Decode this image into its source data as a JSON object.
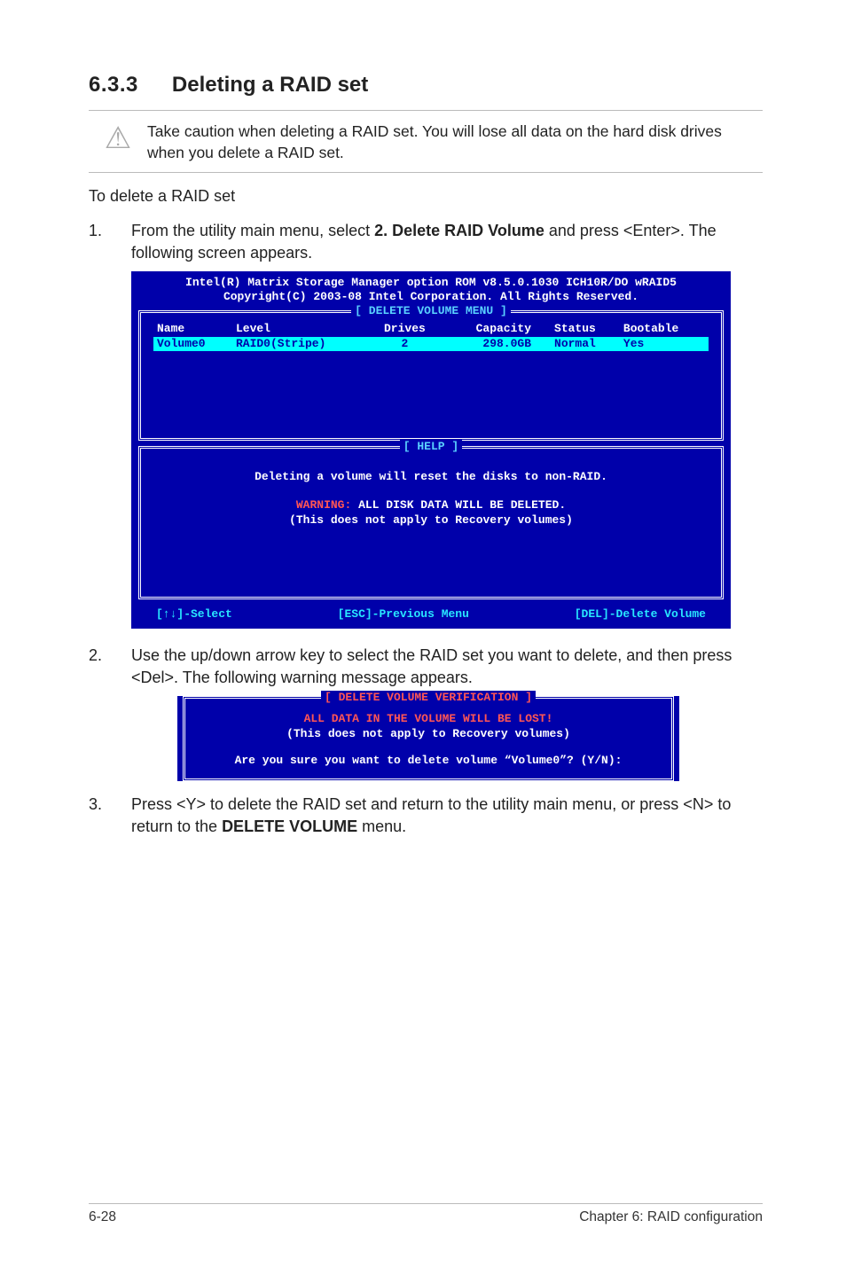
{
  "section": {
    "number": "6.3.3",
    "title": "Deleting a RAID set"
  },
  "caution": {
    "icon_name": "caution-triangle",
    "text": "Take caution when deleting a RAID set. You will lose all data on the hard disk drives when you delete a RAID set."
  },
  "subheading": "To delete a RAID set",
  "step1": {
    "num": "1.",
    "pre": "From the utility main menu, select ",
    "bold": "2. Delete RAID Volume",
    "post": " and press <Enter>. The following screen appears."
  },
  "bios": {
    "title_line1": "Intel(R) Matrix Storage Manager option ROM v8.5.0.1030 ICH10R/DO wRAID5",
    "title_line2": "Copyright(C) 2003-08 Intel Corporation.  All Rights Reserved.",
    "panel1_caption": "[ DELETE VOLUME MENU ]",
    "columns": [
      "Name",
      "Level",
      "Drives",
      "Capacity",
      "Status",
      "Bootable"
    ],
    "row": {
      "name": "Volume0",
      "level": "RAID0(Stripe)",
      "drives": "2",
      "capacity": "298.0GB",
      "status": "Normal",
      "bootable": "Yes"
    },
    "panel2_caption": "[ HELP ]",
    "help_line1": "Deleting a volume will reset the disks to non-RAID.",
    "help_warn_label": "WARNING:",
    "help_warn_rest": " ALL DISK DATA WILL BE DELETED.",
    "help_line3": "(This does not apply to Recovery volumes)",
    "footer": {
      "left": "[↑↓]-Select",
      "mid": "[ESC]-Previous Menu",
      "right": "[DEL]-Delete Volume"
    }
  },
  "step2": {
    "num": "2.",
    "text": "Use the up/down arrow key to select the RAID set you want to delete, and then press <Del>. The following warning message appears."
  },
  "dialog": {
    "caption": "[ DELETE VOLUME VERIFICATION ]",
    "lost": "ALL DATA IN THE VOLUME WILL BE LOST!",
    "recovery": "(This does not apply to Recovery volumes)",
    "question": "Are you sure you want to delete volume “Volume0”? (Y/N):"
  },
  "step3": {
    "num": "3.",
    "pre": "Press <Y> to delete the RAID set and return to the utility main menu, or press <N> to return to the ",
    "bold": "DELETE VOLUME",
    "post": " menu."
  },
  "footer": {
    "left": "6-28",
    "right": "Chapter 6: RAID configuration"
  }
}
